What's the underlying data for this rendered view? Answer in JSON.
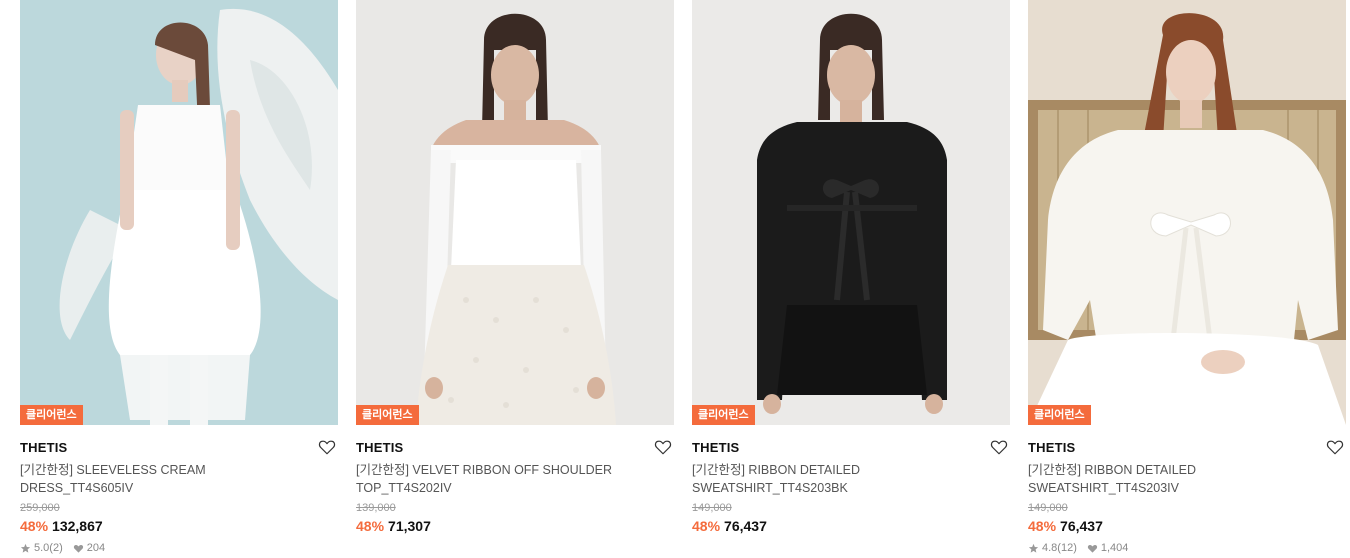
{
  "products": [
    {
      "badge": "클리어런스",
      "brand": "THETIS",
      "name": "[기간한정] SLEEVELESS CREAM DRESS_TT4S605IV",
      "original_price": "259,000",
      "discount": "48%",
      "price": "132,867",
      "rating": "5.0",
      "reviews": "(2)",
      "likes": "204"
    },
    {
      "badge": "클리어런스",
      "brand": "THETIS",
      "name": "[기간한정] VELVET RIBBON OFF SHOULDER TOP_TT4S202IV",
      "original_price": "139,000",
      "discount": "48%",
      "price": "71,307"
    },
    {
      "badge": "클리어런스",
      "brand": "THETIS",
      "name": "[기간한정] RIBBON DETAILED SWEATSHIRT_TT4S203BK",
      "original_price": "149,000",
      "discount": "48%",
      "price": "76,437"
    },
    {
      "badge": "클리어런스",
      "brand": "THETIS",
      "name": "[기간한정] RIBBON DETAILED SWEATSHIRT_TT4S203IV",
      "original_price": "149,000",
      "discount": "48%",
      "price": "76,437",
      "rating": "4.8",
      "reviews": "(12)",
      "likes": "1,404"
    }
  ],
  "icons": {
    "wishlist": "heart-outline-icon",
    "rating": "star-icon",
    "likes": "heart-filled-icon"
  },
  "colors": {
    "accent": "#f46b3c",
    "text": "#111111",
    "muted": "#888888"
  }
}
